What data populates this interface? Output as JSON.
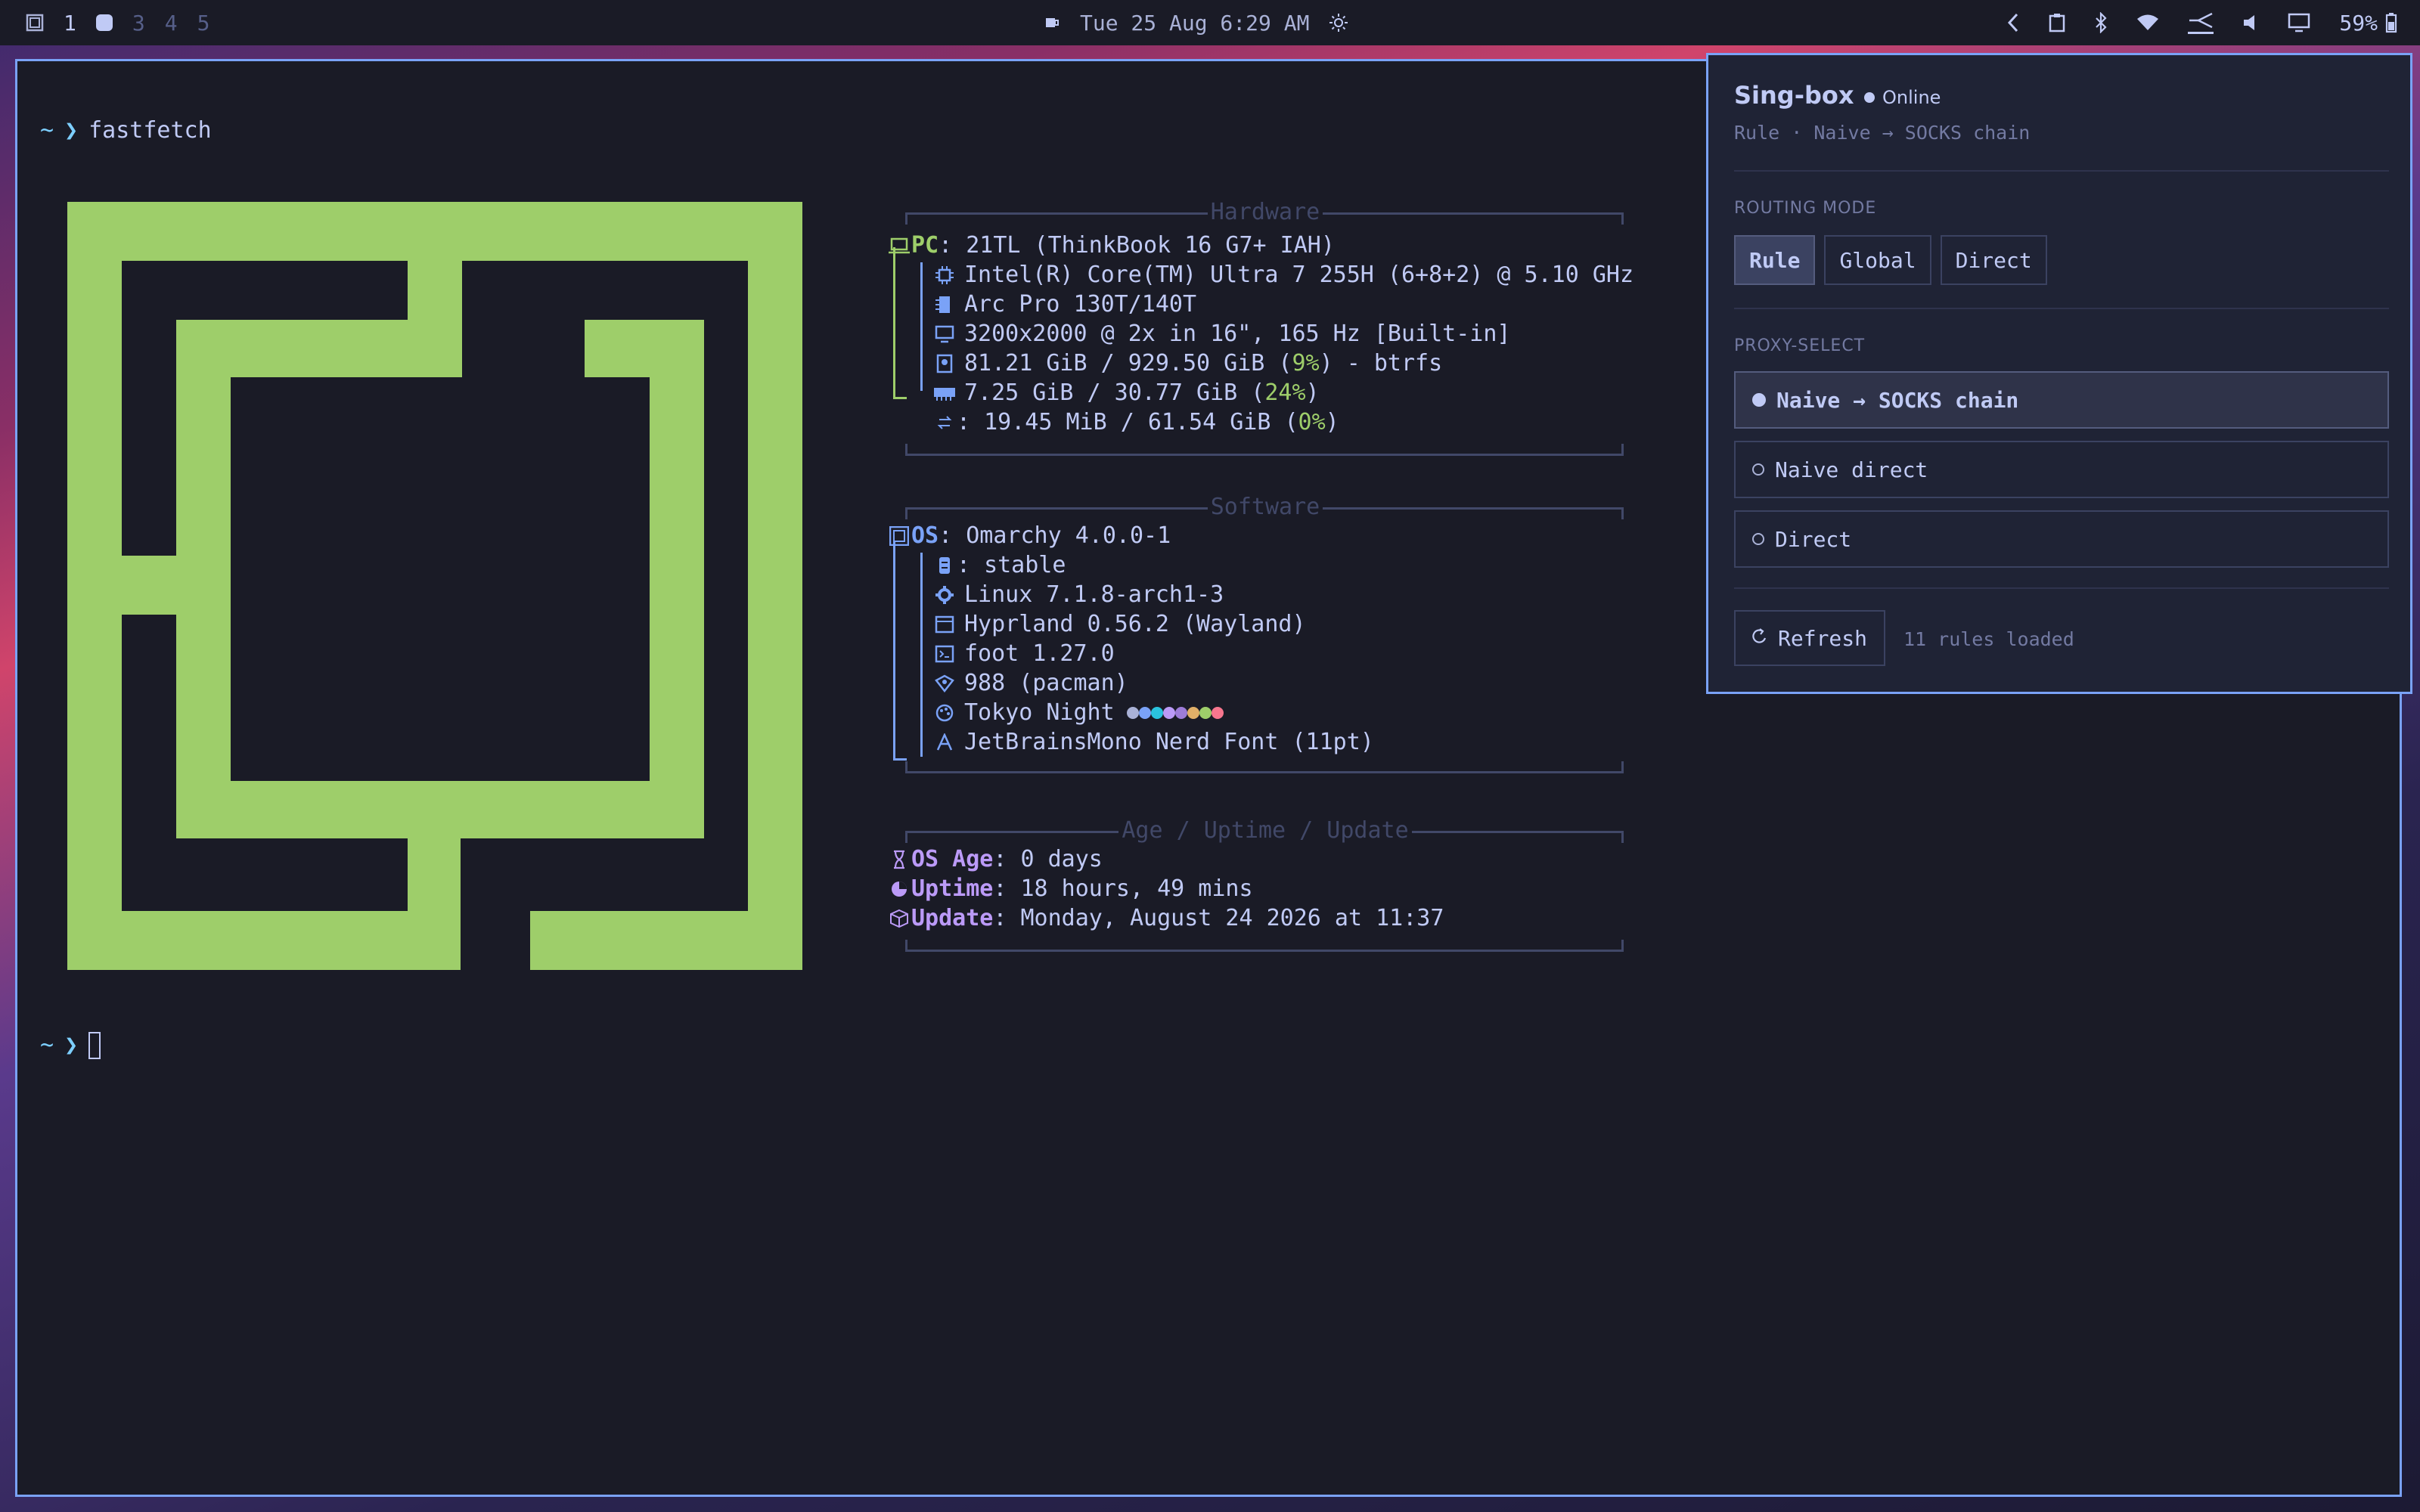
{
  "topbar": {
    "workspaces": [
      "1",
      "3",
      "4",
      "5"
    ],
    "clock": "Tue 25 Aug 6:29 AM",
    "battery": "59%"
  },
  "terminal": {
    "prompt_symbol": "~",
    "prompt_arrow": "❯",
    "command": "fastfetch",
    "logo_color": "#9ece6a"
  },
  "hardware": {
    "title": "Hardware",
    "pc_key": "PC",
    "pc": "21TL (ThinkBook 16 G7+ IAH)",
    "cpu": "Intel(R) Core(TM) Ultra 7 255H (6+8+2) @ 5.10 GHz",
    "gpu": "Arc Pro 130T/140T",
    "display": "3200x2000 @ 2x in 16\", 165 Hz [Built-in]",
    "disk_pre": "81.21 GiB / 929.50 GiB (",
    "disk_pct": "9%",
    "disk_post": ") - btrfs",
    "mem_pre": "7.25 GiB / 30.77 GiB (",
    "mem_pct": "24%",
    "mem_post": ")",
    "swap_pre": ": 19.45 MiB / 61.54 GiB (",
    "swap_pct": "0%",
    "swap_post": ")"
  },
  "software": {
    "title": "Software",
    "os_key": "OS",
    "os": "Omarchy 4.0.0-1",
    "branch_sep": ":",
    "branch": "stable",
    "kernel": "Linux 7.1.8-arch1-3",
    "wm": "Hyprland 0.56.2 (Wayland)",
    "terminal": "foot 1.27.0",
    "packages": "988 (pacman)",
    "theme": "Tokyo Night",
    "theme_colors": [
      "#a9b1d6",
      "#7aa2f7",
      "#2ac3de",
      "#bb9af7",
      "#9d7cd8",
      "#e0af68",
      "#9ece6a",
      "#f7768e"
    ],
    "font": "JetBrainsMono Nerd Font (11pt)"
  },
  "age": {
    "title": "Age / Uptime / Update",
    "os_age_key": "OS Age",
    "os_age": "0 days",
    "uptime_key": "Uptime",
    "uptime": "18 hours, 49 mins",
    "update_key": "Update",
    "update": "Monday, August 24 2026 at 11:37"
  },
  "singbox": {
    "title": "Sing-box",
    "status": "Online",
    "subtitle": "Rule · Naive → SOCKS chain",
    "routing_label": "ROUTING MODE",
    "modes": [
      "Rule",
      "Global",
      "Direct"
    ],
    "active_mode": "Rule",
    "proxy_label": "PROXY-SELECT",
    "proxies": [
      "Naive → SOCKS chain",
      "Naive direct",
      "Direct"
    ],
    "selected_proxy": "Naive → SOCKS chain",
    "refresh_label": "Refresh",
    "rules_info": "11 rules loaded"
  }
}
